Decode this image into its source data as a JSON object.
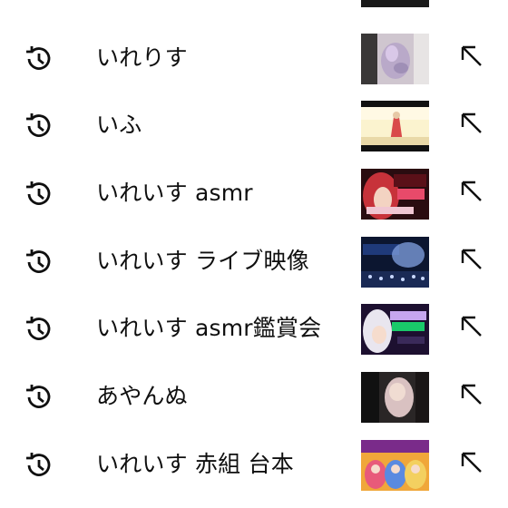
{
  "search_history": {
    "items": [
      {
        "query": "",
        "thumb": "dark-video"
      },
      {
        "query": "いれりす",
        "thumb": "hands-flower"
      },
      {
        "query": "いふ",
        "thumb": "red-figure-sunlight"
      },
      {
        "query": "いれいす asmr",
        "thumb": "anime-red-hair-asmr"
      },
      {
        "query": "いれいす ライブ映像",
        "thumb": "live-concert-stage"
      },
      {
        "query": "いれいす asmr鑑賞会",
        "thumb": "anime-white-hair-asmr"
      },
      {
        "query": "あやんぬ",
        "thumb": "cosplay-dark"
      },
      {
        "query": "いれいす 赤組 台本",
        "thumb": "anime-characters-colorful"
      }
    ],
    "icons": {
      "history": "history-clock-icon",
      "fill": "arrow-up-left-icon"
    }
  }
}
